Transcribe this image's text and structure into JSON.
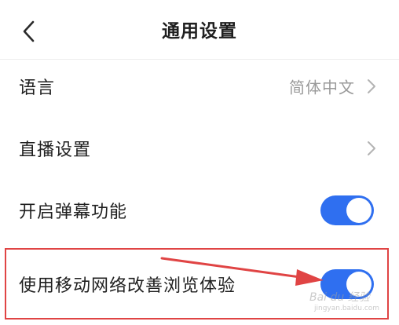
{
  "header": {
    "title": "通用设置",
    "back_icon": "chevron-left-icon"
  },
  "settings": [
    {
      "label": "语言",
      "value": "简体中文",
      "control": "chevron"
    },
    {
      "label": "直播设置",
      "value": "",
      "control": "chevron"
    },
    {
      "label": "开启弹幕功能",
      "control": "toggle",
      "enabled": true
    },
    {
      "label": "使用移动网络改善浏览体验",
      "control": "toggle",
      "enabled": true
    }
  ],
  "colors": {
    "toggle_on": "#2f6ff0",
    "annotation": "#e04444",
    "secondary_text": "#9a9a9a"
  },
  "watermark": {
    "text": "Bai du 经验",
    "sub": "jingyan.baidu.com"
  }
}
